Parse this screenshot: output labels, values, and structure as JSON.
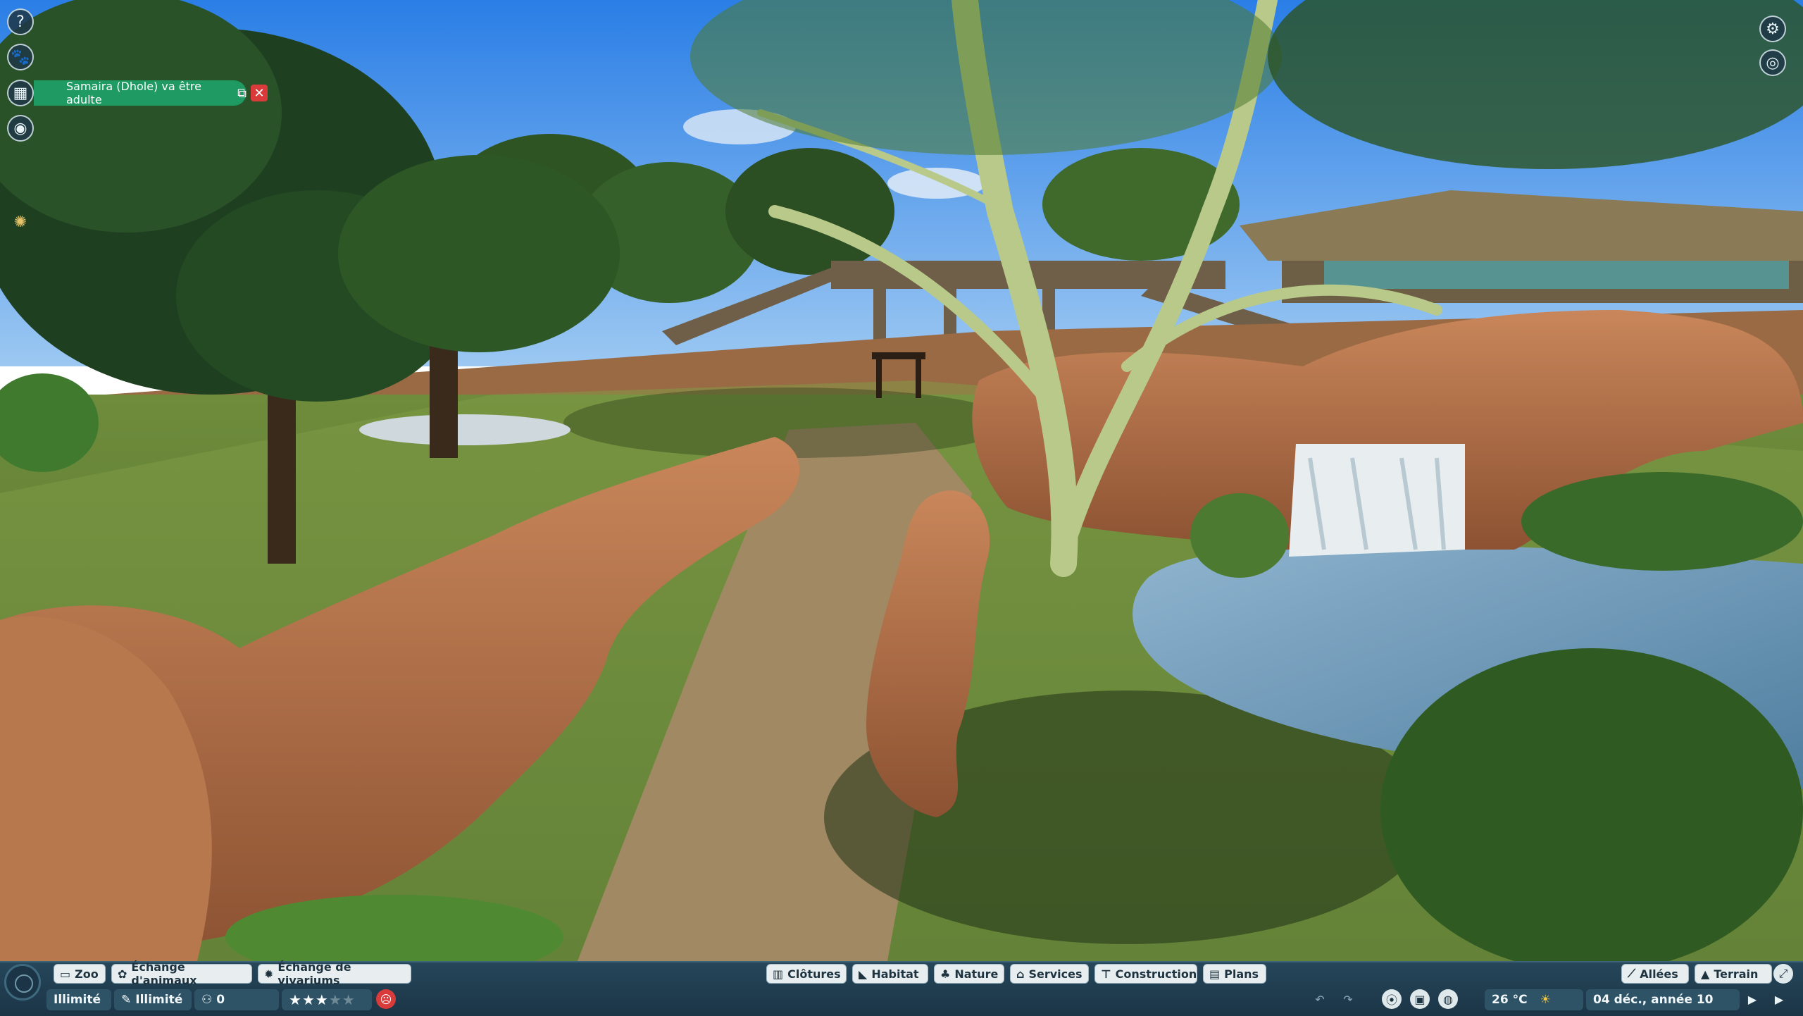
{
  "notification": {
    "text": "Samaira (Dhole) va être adulte",
    "icon": "external-link-icon",
    "close_icon": "close-icon"
  },
  "left_toolbar": [
    {
      "name": "help-icon",
      "glyph": "?"
    },
    {
      "name": "animal-icon",
      "glyph": "🐾"
    },
    {
      "name": "calendar-icon",
      "glyph": "▦"
    },
    {
      "name": "eye-icon",
      "glyph": "◉"
    },
    {
      "name": "sparkle-icon",
      "glyph": "✺"
    }
  ],
  "right_toolbar": [
    {
      "name": "settings-icon",
      "glyph": "⚙"
    },
    {
      "name": "camera-icon",
      "glyph": "◎"
    }
  ],
  "bottom_menu_left": [
    {
      "label": "Zoo",
      "icon": "zoo-icon",
      "glyph": "▭"
    },
    {
      "label": "Échange d'animaux",
      "icon": "paw-icon",
      "glyph": "✿"
    },
    {
      "label": "Échange de vivariums",
      "icon": "vivarium-icon",
      "glyph": "✹"
    }
  ],
  "bottom_menu_center": [
    {
      "label": "Clôtures",
      "icon": "fence-icon",
      "glyph": "▥"
    },
    {
      "label": "Habitat",
      "icon": "habitat-icon",
      "glyph": "◣"
    },
    {
      "label": "Nature",
      "icon": "nature-icon",
      "glyph": "♣"
    },
    {
      "label": "Services",
      "icon": "services-icon",
      "glyph": "⌂"
    },
    {
      "label": "Construction",
      "icon": "construction-icon",
      "glyph": "⊤"
    },
    {
      "label": "Plans",
      "icon": "plans-icon",
      "glyph": "▤"
    }
  ],
  "bottom_menu_right": [
    {
      "label": "Allées",
      "icon": "path-icon",
      "glyph": "⟋"
    },
    {
      "label": "Terrain",
      "icon": "terrain-icon",
      "glyph": "▲"
    }
  ],
  "status": {
    "money": "Illimité",
    "research": "Illimité",
    "guests": "0",
    "rating_stars": 3,
    "rating_max": 5,
    "temperature": "26 °C",
    "weather_icon": "sun-icon",
    "date": "04 déc., année 10"
  },
  "colors": {
    "toolbar_bg": "#1b3546",
    "notification": "#1f9a62",
    "close": "#d93a3a"
  }
}
